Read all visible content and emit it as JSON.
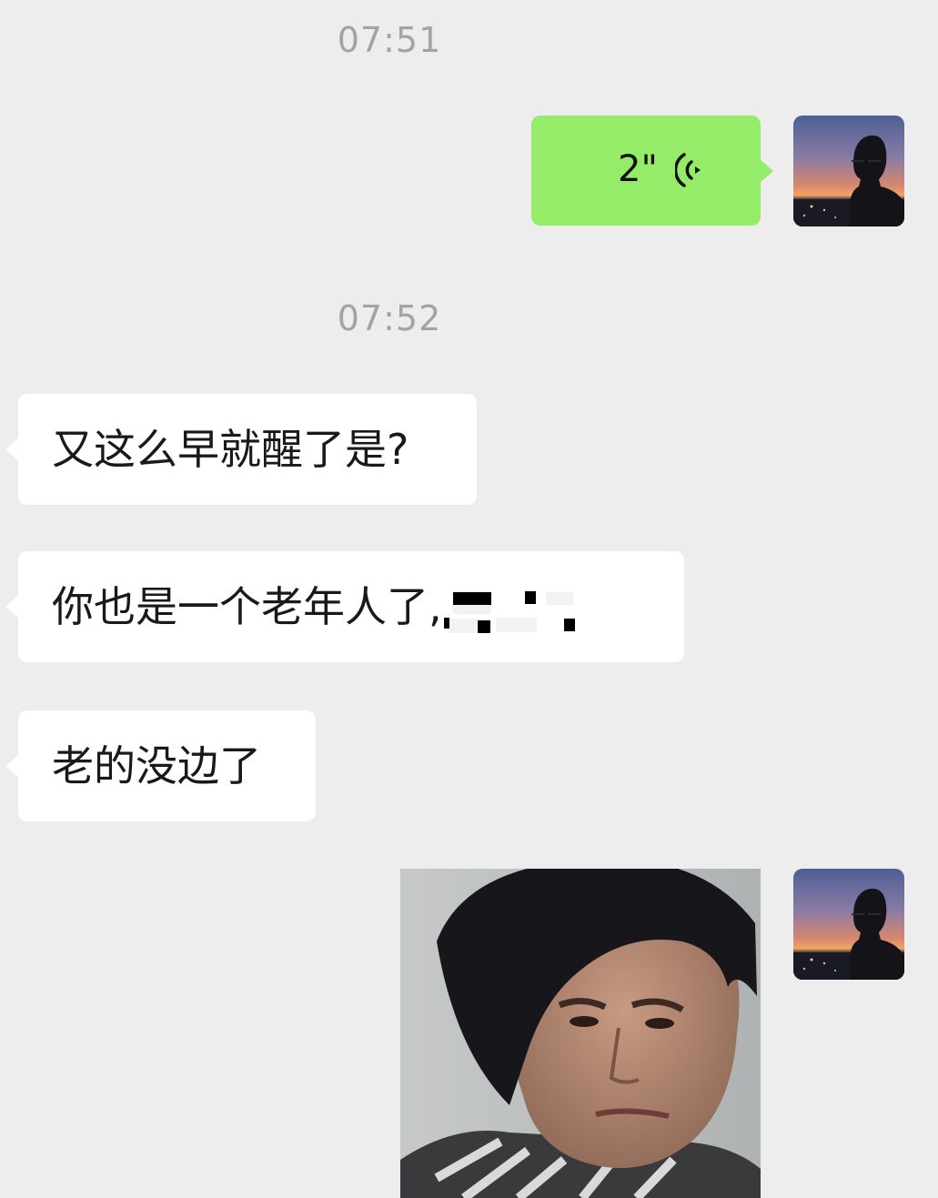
{
  "messages": [
    {
      "type": "timestamp",
      "text": "07:51"
    },
    {
      "type": "voice",
      "sender": "self",
      "duration": "2\""
    },
    {
      "type": "timestamp",
      "text": "07:52"
    },
    {
      "type": "text",
      "sender": "other",
      "text": "又这么早就醒了是?"
    },
    {
      "type": "text",
      "sender": "other",
      "text": "你也是一个老年人了,"
    },
    {
      "type": "text",
      "sender": "other",
      "text": "老的没边了"
    },
    {
      "type": "image",
      "sender": "self"
    }
  ],
  "colors": {
    "background": "#ededed",
    "self_bubble": "#95ec69",
    "other_bubble": "#ffffff",
    "timestamp": "#a3a3a3"
  },
  "icons": {
    "voice": "voice-wave-icon"
  }
}
